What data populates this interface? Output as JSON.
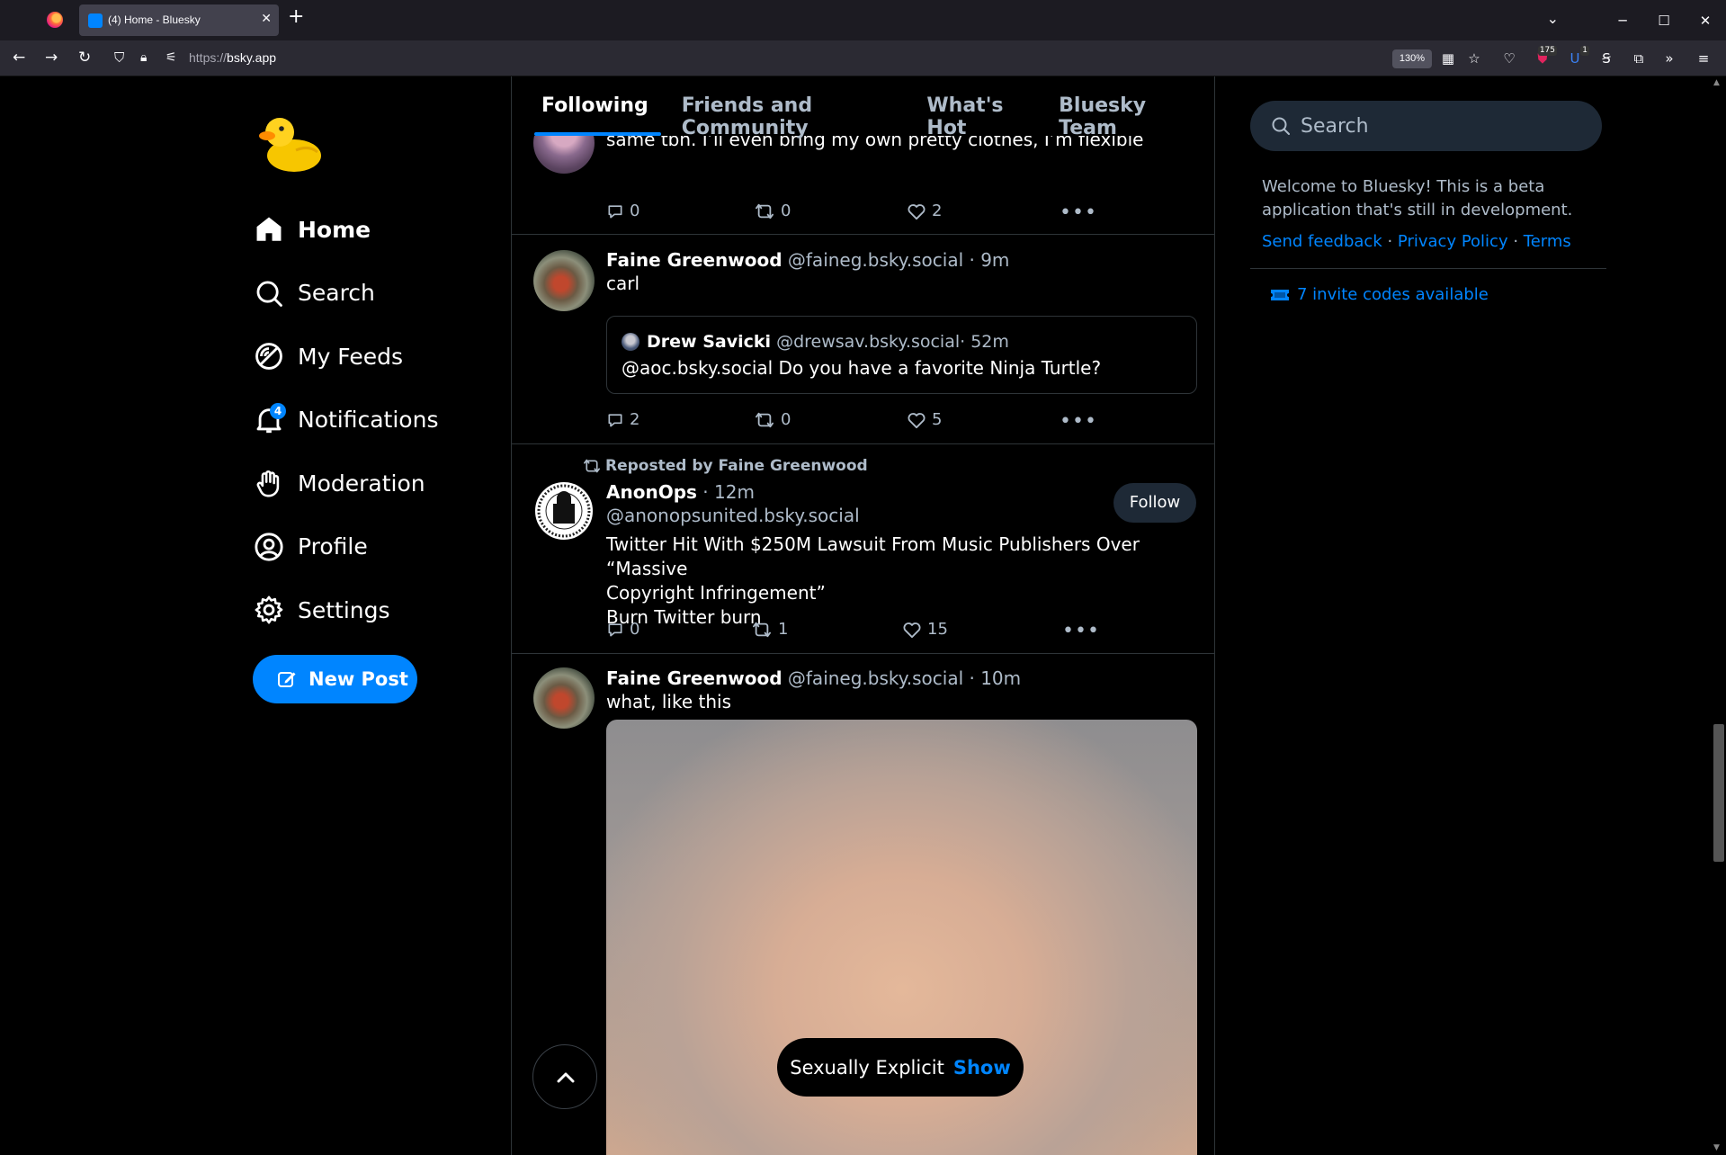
{
  "browser": {
    "tab_title": "(4) Home - Bluesky",
    "url_protocol": "https://",
    "url_host": "bsky.app",
    "zoom": "130%",
    "ext_badge_1": "175",
    "ext_badge_2": "1"
  },
  "sidebar": {
    "items": [
      {
        "label": "Home",
        "icon": "home-icon"
      },
      {
        "label": "Search",
        "icon": "search-icon"
      },
      {
        "label": "My Feeds",
        "icon": "feeds-icon"
      },
      {
        "label": "Notifications",
        "icon": "bell-icon",
        "badge": "4"
      },
      {
        "label": "Moderation",
        "icon": "hand-icon"
      },
      {
        "label": "Profile",
        "icon": "profile-icon"
      },
      {
        "label": "Settings",
        "icon": "gear-icon"
      }
    ],
    "new_post": "New Post"
  },
  "feed": {
    "tabs": [
      "Following",
      "Friends and Community",
      "What's Hot",
      "Bluesky Team"
    ],
    "posts": [
      {
        "text": "same tbh. I’ll even bring my own pretty clothes, I’m flexible",
        "replies": "0",
        "reposts": "0",
        "likes": "2"
      },
      {
        "name": "Faine Greenwood",
        "handle": "@faineg.bsky.social",
        "time": " · 9m",
        "text": "carl",
        "quote": {
          "name": "Drew Savicki",
          "handle": "@drewsav.bsky.social",
          "time": " · 52m",
          "text": "@aoc.bsky.social Do you have a favorite Ninja Turtle?"
        },
        "replies": "2",
        "reposts": "0",
        "likes": "5"
      },
      {
        "repost_by": "Reposted by Faine Greenwood",
        "name": "AnonOps",
        "time": " · 12m",
        "handle": "@anonopsunited.bsky.social",
        "follow": "Follow",
        "text1": "Twitter Hit With $250M Lawsuit From Music Publishers Over “Massive",
        "text2": "Copyright Infringement”",
        "text3": "Burn Twitter burn",
        "replies": "0",
        "reposts": "1",
        "likes": "15"
      },
      {
        "name": "Faine Greenwood",
        "handle": "@faineg.bsky.social",
        "time": " · 10m",
        "text": "what, like this",
        "label": "Sexually Explicit",
        "show": "Show"
      }
    ]
  },
  "right": {
    "search_placeholder": "Search",
    "welcome": "Welcome to Bluesky! This is a beta application that's still in development.",
    "link_feedback": "Send feedback",
    "link_privacy": "Privacy Policy",
    "link_terms": "Terms",
    "sep": " · ",
    "invites": "7 invite codes available"
  },
  "colors": {
    "accent": "#0085ff",
    "muted": "#aebbc9",
    "border": "#2e3438"
  }
}
